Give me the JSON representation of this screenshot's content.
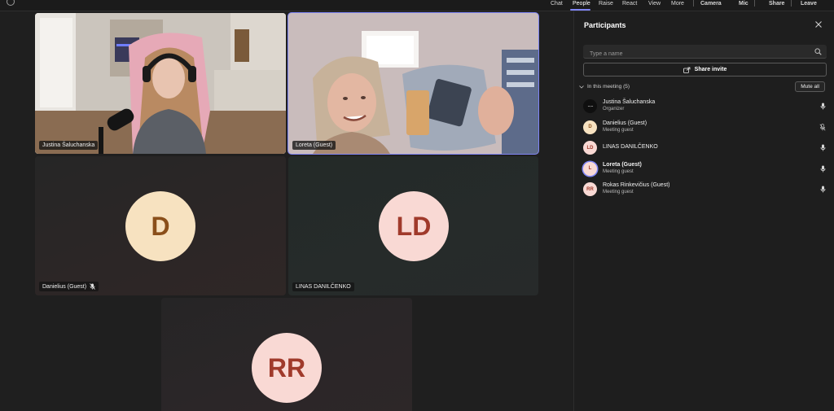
{
  "topbar": {
    "app_label": "",
    "buttons": [
      {
        "label": "Chat"
      },
      {
        "label": "People"
      },
      {
        "label": "Raise"
      },
      {
        "label": "React"
      },
      {
        "label": "View"
      },
      {
        "label": "More"
      },
      {
        "label": "Camera"
      },
      {
        "label": "Mic"
      },
      {
        "label": "Share"
      },
      {
        "label": "Leave"
      }
    ],
    "active": "People"
  },
  "stage": {
    "tiles": [
      {
        "name": "Justina Šaluchanska",
        "type": "video",
        "muted": false
      },
      {
        "name": "Loreta (Guest)",
        "type": "video",
        "muted": false,
        "active_speaker": true
      },
      {
        "name": "Danielius (Guest)",
        "type": "avatar",
        "initials": "D",
        "muted": true,
        "avatar_bg": "#f7e2c0",
        "avatar_fg": "#8a4f1a"
      },
      {
        "name": "LINAS DANILČENKO",
        "type": "avatar",
        "initials": "LD",
        "muted": false,
        "avatar_bg": "#f9d9d4",
        "avatar_fg": "#a03a2b"
      },
      {
        "name": "",
        "type": "avatar",
        "initials": "RR",
        "muted": false,
        "avatar_bg": "#f9d9d4",
        "avatar_fg": "#a03a2b"
      }
    ]
  },
  "participants_panel": {
    "title": "Participants",
    "search_placeholder": "Type a name",
    "share_invite_label": "Share invite",
    "section_label": "In this meeting (5)",
    "mute_all_label": "Mute all",
    "people": [
      {
        "name": "Justina Šaluchanska",
        "role": "Organizer",
        "initials": "",
        "avatar_bg": "#0f0f0f",
        "avatar_fg": "#ffffff",
        "mic": "on"
      },
      {
        "name": "Danielius (Guest)",
        "role": "Meeting guest",
        "initials": "D",
        "avatar_bg": "#f7e2c0",
        "avatar_fg": "#8a4f1a",
        "mic": "off"
      },
      {
        "name": "LINAS DANILČENKO",
        "role": "",
        "initials": "LD",
        "avatar_bg": "#f9d9d4",
        "avatar_fg": "#a03a2b",
        "mic": "on"
      },
      {
        "name": "Loreta (Guest)",
        "role": "Meeting guest",
        "initials": "L",
        "avatar_bg": "#f9d9d4",
        "avatar_fg": "#a03a2b",
        "mic": "on",
        "speaking": true
      },
      {
        "name": "Rokas Rinkevičius (Guest)",
        "role": "Meeting guest",
        "initials": "RR",
        "avatar_bg": "#f9d9d4",
        "avatar_fg": "#a03a2b",
        "mic": "on"
      }
    ]
  },
  "colors": {
    "accent": "#7f85f5",
    "background": "#1f1f1f"
  }
}
